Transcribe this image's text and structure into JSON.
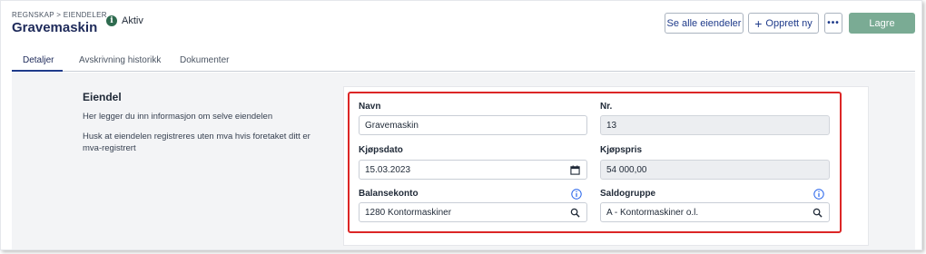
{
  "header": {
    "breadcrumb": "REGNSKAP > EIENDELER",
    "title": "Gravemaskin",
    "status": "Aktiv"
  },
  "toolbar": {
    "see_all_label": "Se alle eiendeler",
    "new_label": "Opprett ny",
    "more_label": "•••",
    "save_label": "Lagre"
  },
  "tabs": [
    {
      "label": "Detaljer",
      "active": true
    },
    {
      "label": "Avskrivning historikk",
      "active": false
    },
    {
      "label": "Dokumenter",
      "active": false
    }
  ],
  "section": {
    "title": "Eiendel",
    "description_1": "Her legger du inn informasjon om selve eiendelen",
    "description_2": "Husk at eiendelen registreres uten mva hvis foretaket ditt er mva-registrert"
  },
  "form": {
    "name": {
      "label": "Navn",
      "value": "Gravemaskin"
    },
    "number": {
      "label": "Nr.",
      "value": "13"
    },
    "purchase_date": {
      "label": "Kjøpsdato",
      "value": "15.03.2023"
    },
    "purchase_price": {
      "label": "Kjøpspris",
      "value": "54 000,00"
    },
    "balance_account": {
      "label": "Balansekonto",
      "value": "1280 Kontormaskiner"
    },
    "balance_group": {
      "label": "Saldogruppe",
      "value": "A - Kontormaskiner o.l."
    }
  },
  "colors": {
    "brand": "#1e2a5a",
    "accent": "#1e3a8a",
    "save_button": "#7aab94",
    "status_active": "#2e6b4f",
    "highlight": "#dc2626"
  },
  "icons": {
    "status": "info-circle-icon",
    "date": "calendar-icon",
    "search": "search-icon",
    "info": "info-icon"
  }
}
